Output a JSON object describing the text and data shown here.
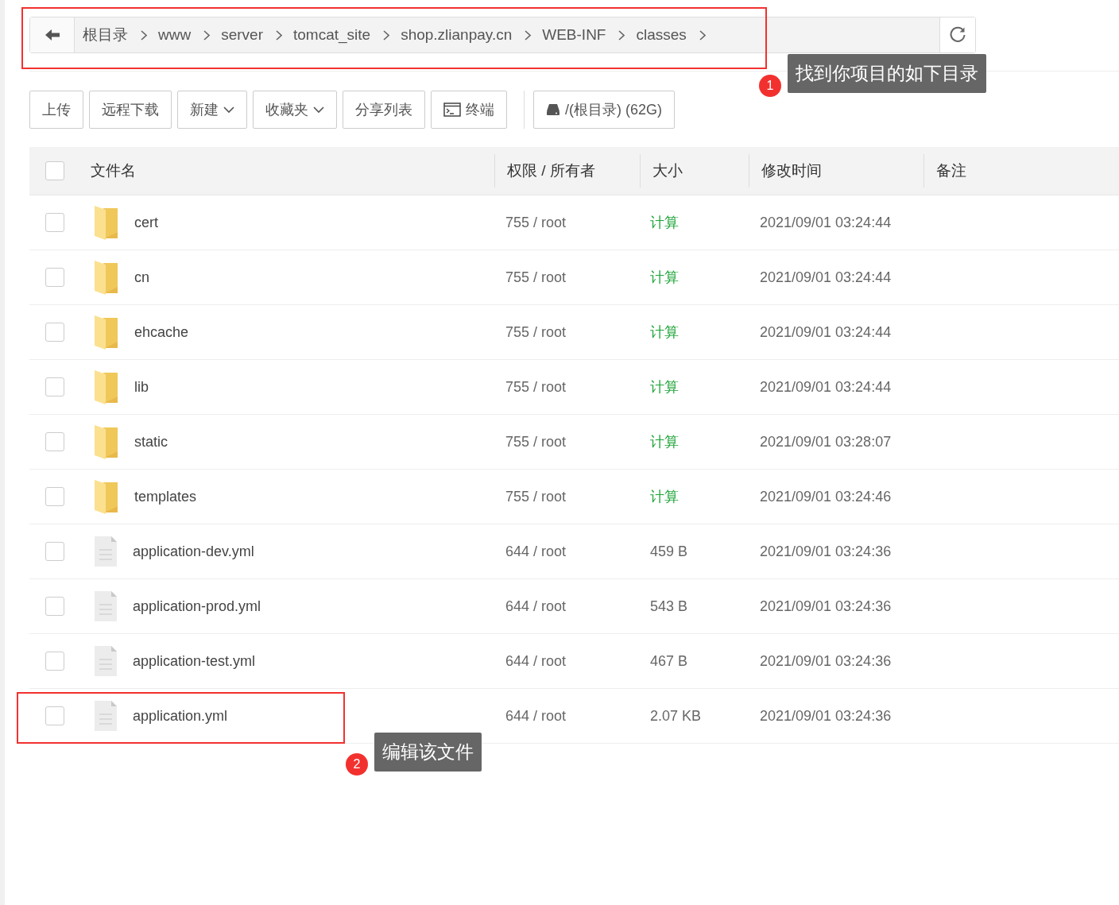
{
  "breadcrumb": {
    "items": [
      "根目录",
      "www",
      "server",
      "tomcat_site",
      "shop.zlianpay.cn",
      "WEB-INF",
      "classes"
    ]
  },
  "toolbar": {
    "buttons": [
      {
        "label": "上传",
        "kind": "plain"
      },
      {
        "label": "远程下载",
        "kind": "plain"
      },
      {
        "label": "新建",
        "kind": "dropdown"
      },
      {
        "label": "收藏夹",
        "kind": "dropdown"
      },
      {
        "label": "分享列表",
        "kind": "plain"
      },
      {
        "label": "终端",
        "kind": "terminal"
      },
      {
        "label": "/(根目录) (62G)",
        "kind": "disk"
      }
    ]
  },
  "table": {
    "select_all": {
      "checked": false
    },
    "columns": [
      "文件名",
      "权限 / 所有者",
      "大小",
      "修改时间",
      "备注"
    ],
    "rows": [
      {
        "kind": "folder",
        "name": "cert",
        "permissions": "755 / root",
        "size": "计算",
        "modified": "2021/09/01 03:24:44",
        "checked": false
      },
      {
        "kind": "folder",
        "name": "cn",
        "permissions": "755 / root",
        "size": "计算",
        "modified": "2021/09/01 03:24:44",
        "checked": false
      },
      {
        "kind": "folder",
        "name": "ehcache",
        "permissions": "755 / root",
        "size": "计算",
        "modified": "2021/09/01 03:24:44",
        "checked": false
      },
      {
        "kind": "folder",
        "name": "lib",
        "permissions": "755 / root",
        "size": "计算",
        "modified": "2021/09/01 03:24:44",
        "checked": false
      },
      {
        "kind": "folder",
        "name": "static",
        "permissions": "755 / root",
        "size": "计算",
        "modified": "2021/09/01 03:28:07",
        "checked": false
      },
      {
        "kind": "folder",
        "name": "templates",
        "permissions": "755 / root",
        "size": "计算",
        "modified": "2021/09/01 03:24:46",
        "checked": false
      },
      {
        "kind": "file",
        "name": "application-dev.yml",
        "permissions": "644 / root",
        "size": "459 B",
        "modified": "2021/09/01 03:24:36",
        "checked": false
      },
      {
        "kind": "file",
        "name": "application-prod.yml",
        "permissions": "644 / root",
        "size": "543 B",
        "modified": "2021/09/01 03:24:36",
        "checked": false
      },
      {
        "kind": "file",
        "name": "application-test.yml",
        "permissions": "644 / root",
        "size": "467 B",
        "modified": "2021/09/01 03:24:36",
        "checked": false
      },
      {
        "kind": "file",
        "name": "application.yml",
        "permissions": "644 / root",
        "size": "2.07 KB",
        "modified": "2021/09/01 03:24:36",
        "checked": false
      }
    ]
  },
  "annotations": [
    {
      "number": "1",
      "text": "找到你项目的如下目录"
    },
    {
      "number": "2",
      "text": "编辑该文件"
    }
  ]
}
